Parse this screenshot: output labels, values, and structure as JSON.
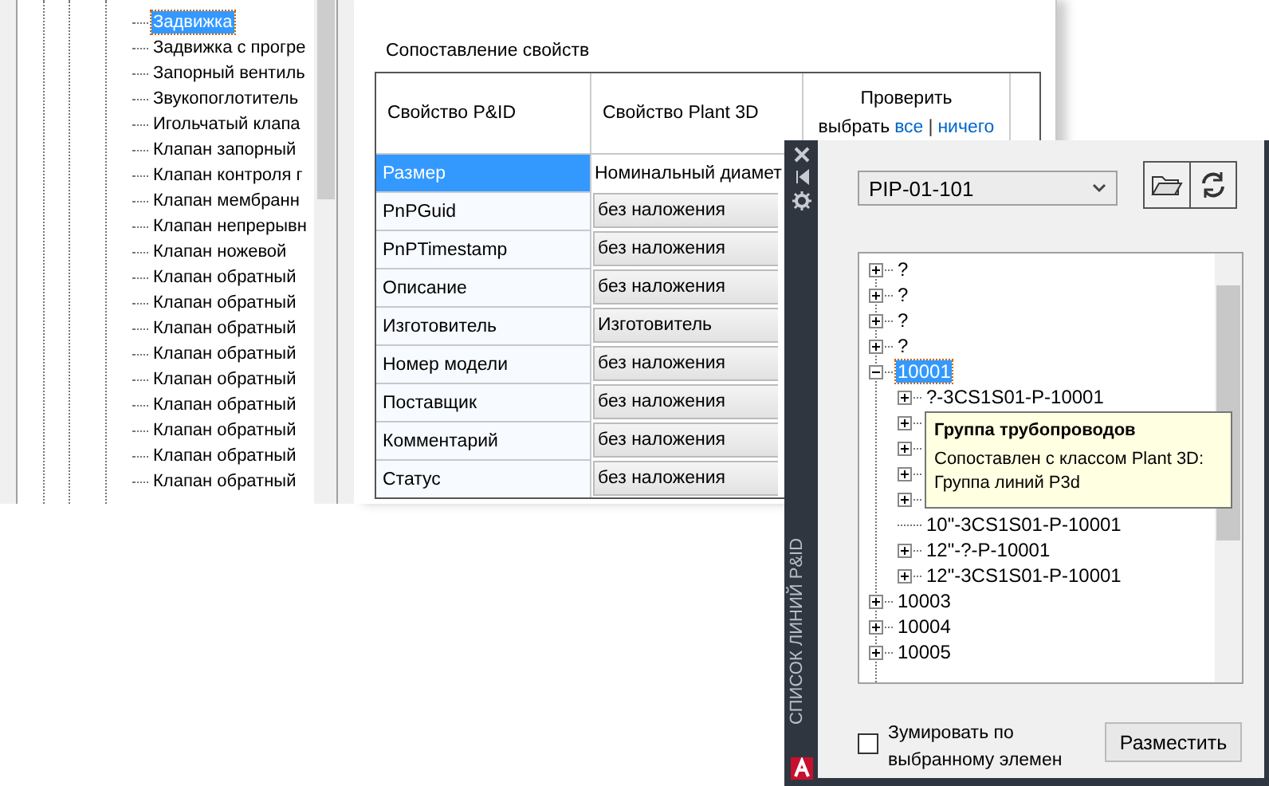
{
  "left_tree": {
    "items": [
      {
        "label": "Задвижка",
        "selected": true
      },
      {
        "label": "Задвижка с прогре",
        "selected": false
      },
      {
        "label": "Запорный вентиль",
        "selected": false
      },
      {
        "label": "Звукопоглотитель",
        "selected": false
      },
      {
        "label": "Игольчатый клапа",
        "selected": false
      },
      {
        "label": "Клапан запорный",
        "selected": false
      },
      {
        "label": "Клапан контроля г",
        "selected": false
      },
      {
        "label": "Клапан мембранн",
        "selected": false
      },
      {
        "label": "Клапан непрерывн",
        "selected": false
      },
      {
        "label": "Клапан ножевой",
        "selected": false
      },
      {
        "label": "Клапан обратный",
        "selected": false
      },
      {
        "label": "Клапан обратный",
        "selected": false
      },
      {
        "label": "Клапан обратный",
        "selected": false
      },
      {
        "label": "Клапан обратный",
        "selected": false
      },
      {
        "label": "Клапан обратный",
        "selected": false
      },
      {
        "label": "Клапан обратный",
        "selected": false
      },
      {
        "label": "Клапан обратный",
        "selected": false
      },
      {
        "label": "Клапан обратный",
        "selected": false
      },
      {
        "label": "Клапан обратный",
        "selected": false
      }
    ]
  },
  "mapping": {
    "title": "Сопоставление свойств",
    "columns": [
      "Свойство P&ID",
      "Свойство Plant 3D"
    ],
    "check_header": {
      "label": "Проверить",
      "prefix": "выбрать",
      "all_link": "все",
      "separator": "|",
      "none_link": "ничего"
    },
    "rows": [
      {
        "pid": "Размер",
        "plant": "Номинальный диамет",
        "kind": "text",
        "selected": true
      },
      {
        "pid": "PnPGuid",
        "plant": "без наложения",
        "kind": "dropdown",
        "selected": false
      },
      {
        "pid": "PnPTimestamp",
        "plant": "без наложения",
        "kind": "dropdown",
        "selected": false
      },
      {
        "pid": "Описание",
        "plant": "без наложения",
        "kind": "dropdown",
        "selected": false
      },
      {
        "pid": "Изготовитель",
        "plant": "Изготовитель",
        "kind": "dropdown",
        "selected": false
      },
      {
        "pid": "Номер модели",
        "plant": "без наложения",
        "kind": "dropdown",
        "selected": false
      },
      {
        "pid": "Поставщик",
        "plant": "без наложения",
        "kind": "dropdown",
        "selected": false
      },
      {
        "pid": "Комментарий",
        "plant": "без наложения",
        "kind": "dropdown",
        "selected": false
      },
      {
        "pid": "Статус",
        "plant": "без наложения",
        "kind": "dropdown",
        "selected": false
      }
    ]
  },
  "palette": {
    "title": "СПИСОК ЛИНИЙ P&ID",
    "drawing": "PIP-01-101",
    "tree": [
      {
        "label": "?",
        "expanded": false,
        "selected": false
      },
      {
        "label": "?",
        "expanded": false,
        "selected": false
      },
      {
        "label": "?",
        "expanded": false,
        "selected": false
      },
      {
        "label": "?",
        "expanded": false,
        "selected": false
      },
      {
        "label": "10001",
        "expanded": true,
        "selected": true,
        "children": [
          {
            "label": "?-3CS1S01-P-10001",
            "expanded": false,
            "selected": false
          },
          {
            "expanded": false
          },
          {
            "expanded": false
          },
          {
            "expanded": false
          },
          {
            "expanded": false
          },
          {
            "label": "10\"-3CS1S01-P-10001",
            "selected": false
          },
          {
            "label": "12\"-?-P-10001",
            "expanded": false,
            "selected": false
          },
          {
            "label": "12\"-3CS1S01-P-10001",
            "expanded": false,
            "selected": false
          }
        ]
      },
      {
        "label": "10003",
        "expanded": false,
        "selected": false
      },
      {
        "label": "10004",
        "expanded": false,
        "selected": false
      },
      {
        "label": "10005",
        "expanded": false,
        "selected": false
      }
    ],
    "tooltip": {
      "title": "Группа трубопроводов",
      "lines": [
        "Сопоставлен с классом Plant 3D:",
        "Группа линий P3d"
      ]
    },
    "zoom_checkbox": {
      "lines": [
        "Зумировать по",
        "выбранному элемен"
      ],
      "checked": false
    },
    "place_button": "Разместить"
  }
}
